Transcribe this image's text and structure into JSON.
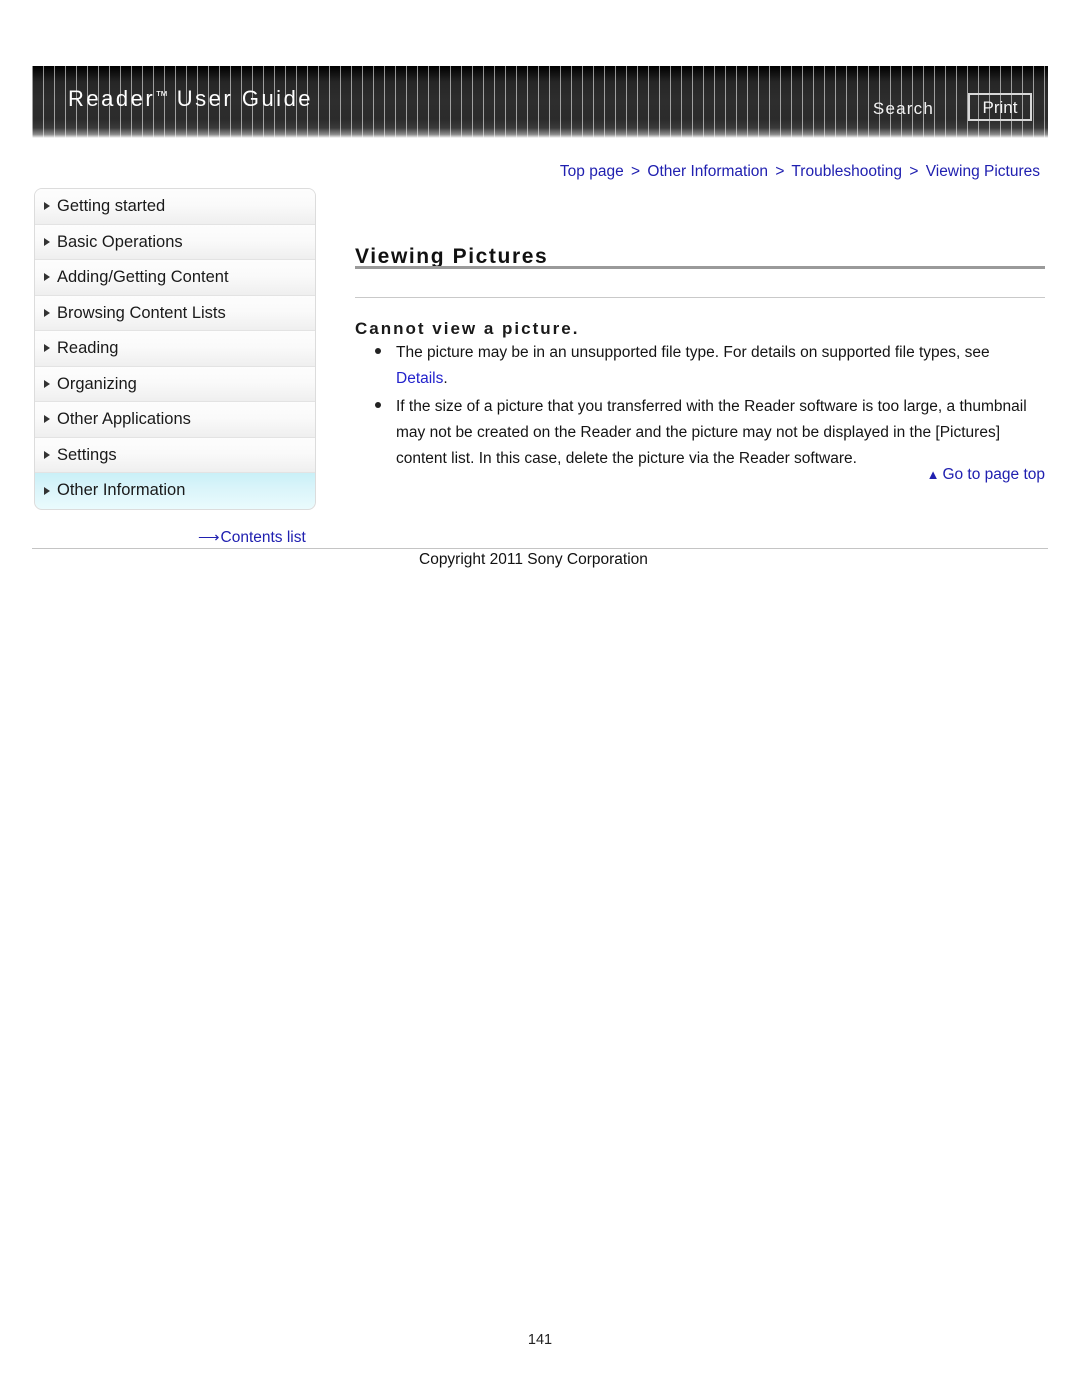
{
  "header": {
    "title_main": "Reader",
    "title_tm": "™",
    "title_rest": " User Guide",
    "search_label": "Search",
    "print_label": "Print"
  },
  "breadcrumb": {
    "separator": ">",
    "items": [
      {
        "label": "Top page"
      },
      {
        "label": "Other Information"
      },
      {
        "label": "Troubleshooting"
      },
      {
        "label": "Viewing Pictures"
      }
    ]
  },
  "sidebar": {
    "items": [
      {
        "label": "Getting started",
        "active": false
      },
      {
        "label": "Basic Operations",
        "active": false
      },
      {
        "label": "Adding/Getting Content",
        "active": false
      },
      {
        "label": "Browsing Content Lists",
        "active": false
      },
      {
        "label": "Reading",
        "active": false
      },
      {
        "label": "Organizing",
        "active": false
      },
      {
        "label": "Other Applications",
        "active": false
      },
      {
        "label": "Settings",
        "active": false
      },
      {
        "label": "Other Information",
        "active": true
      }
    ],
    "contents_list": {
      "arrow": "⟶",
      "label": "Contents list"
    }
  },
  "main": {
    "page_title": "Viewing Pictures",
    "section_title": "Cannot view a picture.",
    "bullets": [
      {
        "text_before": "The picture may be in an unsupported file type. For details on supported file types, see ",
        "link": "Details",
        "text_after": "."
      },
      {
        "text_before": "If the size of a picture that you transferred with the Reader software is too large, a thumbnail may not be created on the Reader and the picture may not be displayed in the [Pictures] content list. In this case, delete the picture via the Reader software.",
        "link": "",
        "text_after": ""
      }
    ],
    "go_to_top": {
      "arrow": "▲",
      "label": "Go to page top"
    }
  },
  "footer": {
    "copyright": "Copyright 2011 Sony Corporation",
    "page_number": "141"
  },
  "colors": {
    "link": "#2020b0",
    "inline_link": "#2222cc",
    "active_nav": "#d9f4fa",
    "banner_dark": "#2e2e2e"
  }
}
